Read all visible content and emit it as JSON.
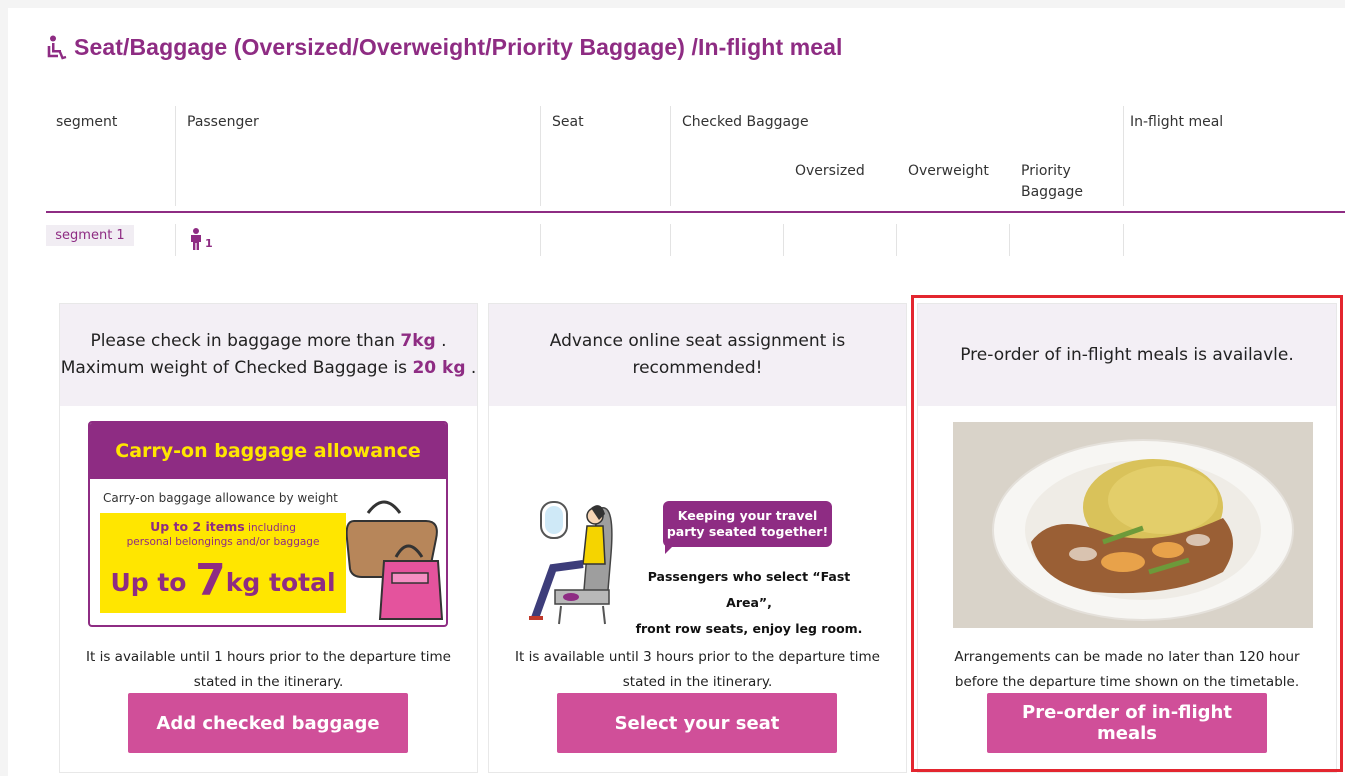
{
  "page": {
    "title": "Seat/Baggage (Oversized/Overweight/Priority Baggage) /In-flight meal"
  },
  "table": {
    "headers": {
      "segment": "segment",
      "passenger": "Passenger",
      "seat": "Seat",
      "checked_baggage": "Checked Baggage",
      "oversized": "Oversized",
      "overweight": "Overweight",
      "priority_line1": "Priority",
      "priority_line2": "Baggage",
      "inflight_meal": "In-flight meal"
    },
    "rows": [
      {
        "segment": "segment 1",
        "passenger_count": "1"
      }
    ]
  },
  "cards": {
    "baggage": {
      "head_part1": "Please check in baggage more than ",
      "head_min_weight": "7kg",
      "head_part2": " .",
      "head_part3": "Maximum weight of Checked Baggage is ",
      "head_max_weight": "20 kg",
      "head_part4": " .",
      "illustration": {
        "title": "Carry-on baggage allowance",
        "subtitle": "Carry-on baggage allowance by weight",
        "items_main": "Up to 2 items",
        "items_small": " including",
        "items_line2": "personal belongings and/or baggage",
        "total_prefix": "Up to ",
        "total_number": "7",
        "total_suffix": "kg total"
      },
      "note_line1": "It is available until 1 hours prior to the departure time",
      "note_line2": "stated in the itinerary.",
      "button": "Add checked baggage"
    },
    "seat": {
      "head_line1": "Advance online seat assignment is",
      "head_line2": "recommended!",
      "illustration": {
        "bubble_line1": "Keeping your travel",
        "bubble_line2": "party seated together!",
        "text_line1": "Passengers who select “Fast Area”,",
        "text_line2": "front row seats, enjoy leg room."
      },
      "note_line1": "It is available until 3 hours prior to the departure time",
      "note_line2": "stated in the itinerary.",
      "button": "Select your seat"
    },
    "meal": {
      "head": "Pre-order of in-flight meals is availavle.",
      "note_line1": "Arrangements can be made no later than 120 hour",
      "note_line2": "before the departure time shown on the timetable.",
      "button": "Pre-order of in-flight meals"
    }
  },
  "colors": {
    "brand": "#8e2c83",
    "button": "#d04f99",
    "highlight_border": "#e3262f",
    "card_head_bg": "#f3eff5",
    "carry_yellow": "#ffe600"
  },
  "icons": [
    "wheelchair-icon",
    "person-icon"
  ]
}
